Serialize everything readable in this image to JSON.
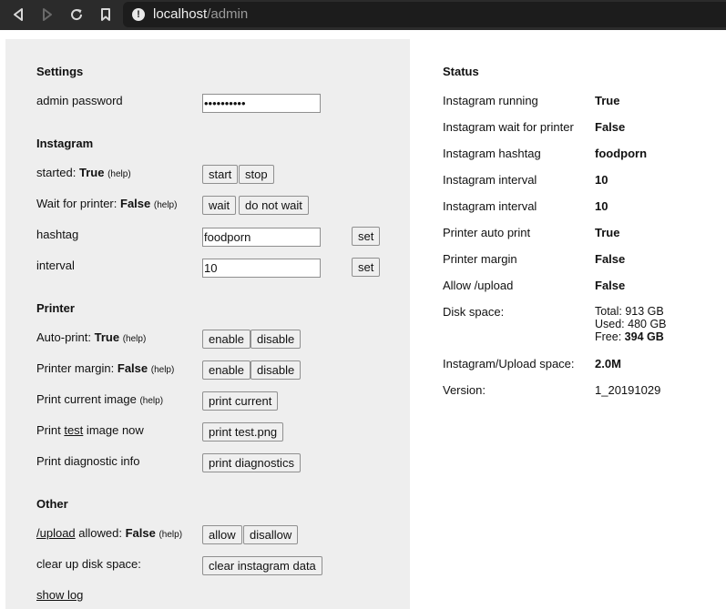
{
  "browser": {
    "url_host": "localhost",
    "url_path": "/admin"
  },
  "settings": {
    "title": "Settings",
    "admin_password_label": "admin password",
    "admin_password_value": "••••••••••"
  },
  "instagram": {
    "title": "Instagram",
    "started_label": "started:",
    "started_value": "True",
    "started_help": "(help)",
    "start_button": "start",
    "stop_button": "stop",
    "wait_label": "Wait for printer:",
    "wait_value": "False",
    "wait_help": "(help)",
    "wait_button": "wait",
    "do_not_wait_button": "do not wait",
    "hashtag_label": "hashtag",
    "hashtag_value": "foodporn",
    "hashtag_set": "set",
    "interval_label": "interval",
    "interval_value": "10",
    "interval_set": "set"
  },
  "printer": {
    "title": "Printer",
    "autoprint_label": "Auto-print:",
    "autoprint_value": "True",
    "autoprint_help": "(help)",
    "autoprint_enable": "enable",
    "autoprint_disable": "disable",
    "margin_label": "Printer margin:",
    "margin_value": "False",
    "margin_help": "(help)",
    "margin_enable": "enable",
    "margin_disable": "disable",
    "print_current_label": "Print current image",
    "print_current_help": "(help)",
    "print_current_button": "print current",
    "print_test_label_pre": "Print ",
    "print_test_label_link": "test",
    "print_test_label_post": " image now",
    "print_test_button": "print test.png",
    "diag_label": "Print diagnostic info",
    "diag_button": "print diagnostics"
  },
  "other": {
    "title": "Other",
    "upload_link": "/upload",
    "upload_label": " allowed:",
    "upload_value": "False",
    "upload_help": "(help)",
    "allow_button": "allow",
    "disallow_button": "disallow",
    "cleanup_label": "clear up disk space:",
    "cleanup_button": "clear instagram data",
    "show_log_link": "show log"
  },
  "status": {
    "title": "Status",
    "rows": [
      {
        "label": "Instagram running",
        "value": "True"
      },
      {
        "label": "Instagram wait for printer",
        "value": "False"
      },
      {
        "label": "Instagram hashtag",
        "value": "foodporn"
      },
      {
        "label": "Instagram interval",
        "value": "10"
      },
      {
        "label": "Instagram interval",
        "value": "10"
      },
      {
        "label": "Printer auto print",
        "value": "True"
      },
      {
        "label": "Printer margin",
        "value": "False"
      },
      {
        "label": "Allow /upload",
        "value": "False"
      }
    ],
    "disk_label": "Disk space:",
    "disk_total": "Total: 913 GB",
    "disk_used": "Used: 480 GB",
    "disk_free_label": "Free:",
    "disk_free_value": "394 GB",
    "upload_space_label": "Instagram/Upload space:",
    "upload_space_value": "2.0M",
    "version_label": "Version:",
    "version_value": "1_20191029"
  }
}
